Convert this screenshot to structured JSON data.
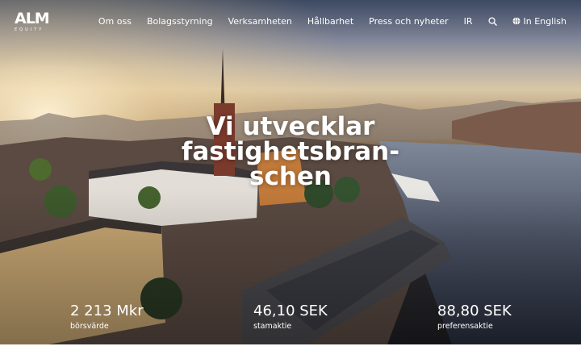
{
  "brand": {
    "logo_text": "ALM",
    "logo_sub": "EQUITY"
  },
  "nav": {
    "items": [
      {
        "label": "Om oss"
      },
      {
        "label": "Bolagsstyrning"
      },
      {
        "label": "Verksamheten"
      },
      {
        "label": "Hållbarhet"
      },
      {
        "label": "Press och nyheter"
      },
      {
        "label": "IR"
      }
    ],
    "search_icon": "search-icon",
    "language_icon": "globe-icon",
    "language_label": "In English"
  },
  "hero": {
    "headline_lines": [
      "Vi utvecklar",
      "fastighetsbran-",
      "schen"
    ]
  },
  "stats": [
    {
      "value": "2 213 Mkr",
      "label": "börsvärde"
    },
    {
      "value": "46,10 SEK",
      "label": "stamaktie"
    },
    {
      "value": "88,80 SEK",
      "label": "preferensaktie"
    }
  ],
  "colors": {
    "text_on_hero": "#ffffff",
    "page_background": "#ffffff"
  }
}
